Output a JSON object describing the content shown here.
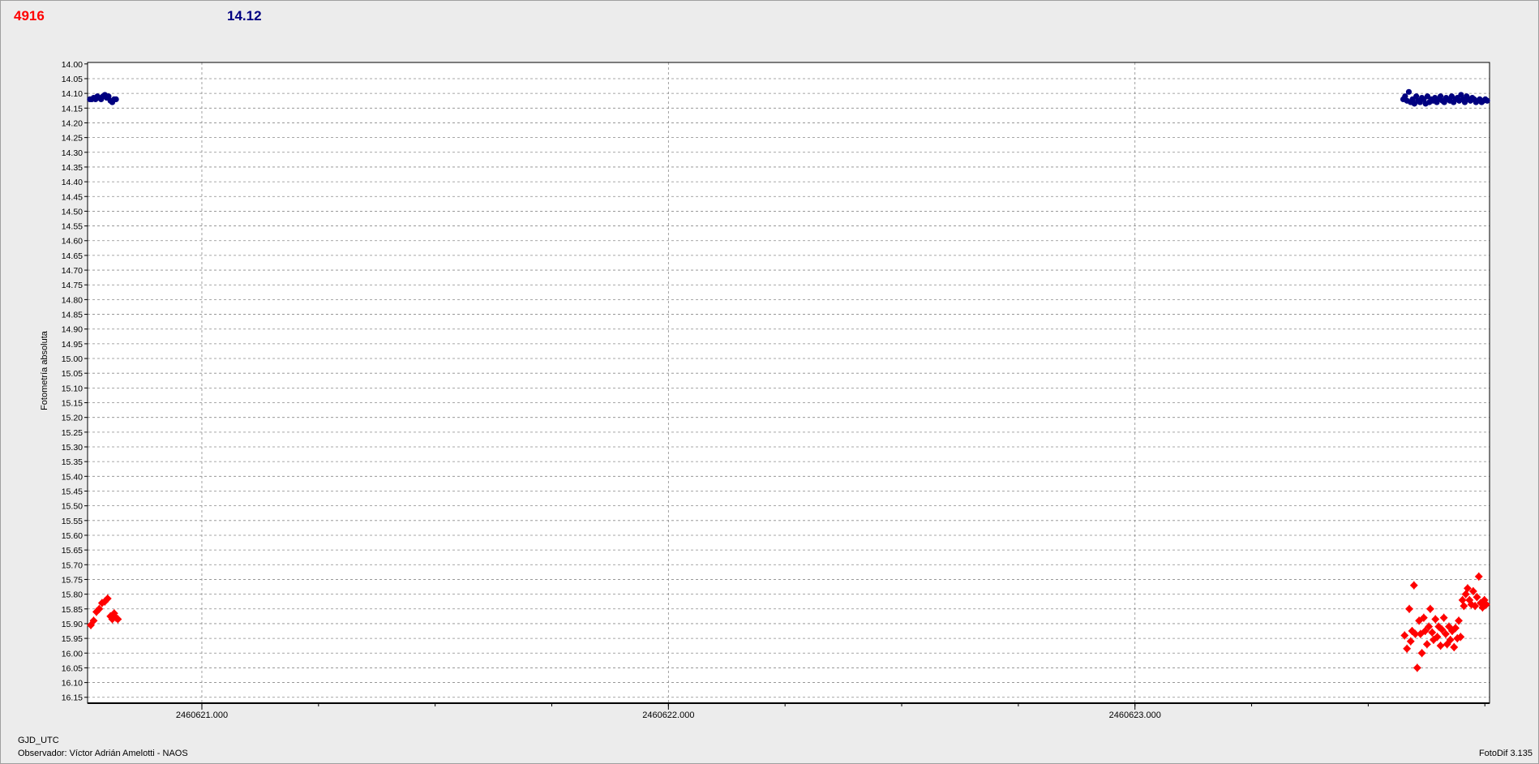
{
  "legend": [
    {
      "text": "4916",
      "color": "#ff0000"
    },
    {
      "text": "14.12",
      "color": "#000080"
    }
  ],
  "footer": {
    "xlabel": "GJD_UTC",
    "observer": "Observador: Víctor Adrián Amelotti - NAOS",
    "software": "FotoDif 3.135"
  },
  "chart_data": {
    "type": "scatter",
    "ylabel": "Fotometría absoluta",
    "xlabel": "GJD_UTC",
    "xlim": [
      2460620.755,
      2460623.76
    ],
    "ylim": [
      16.17,
      13.995
    ],
    "y_inverted": true,
    "y_ticks": [
      14.0,
      14.05,
      14.1,
      14.15,
      14.2,
      14.25,
      14.3,
      14.35,
      14.4,
      14.45,
      14.5,
      14.55,
      14.6,
      14.65,
      14.7,
      14.75,
      14.8,
      14.85,
      14.9,
      14.95,
      15.0,
      15.05,
      15.1,
      15.15,
      15.2,
      15.25,
      15.3,
      15.35,
      15.4,
      15.45,
      15.5,
      15.55,
      15.6,
      15.65,
      15.7,
      15.75,
      15.8,
      15.85,
      15.9,
      15.95,
      16.0,
      16.05,
      16.1,
      16.15
    ],
    "x_major_ticks": [
      {
        "value": 2460621.0,
        "label": "2460621.000"
      },
      {
        "value": 2460622.0,
        "label": "2460622.000"
      },
      {
        "value": 2460623.0,
        "label": "2460623.000"
      }
    ],
    "x_minor_step": 0.25,
    "grid": true,
    "series": [
      {
        "name": "14.12",
        "color": "#000080",
        "marker": "circle",
        "x": [
          2460620.76,
          2460620.764,
          2460620.768,
          2460620.772,
          2460620.776,
          2460620.78,
          2460620.784,
          2460620.788,
          2460620.792,
          2460620.796,
          2460620.8,
          2460620.804,
          2460620.808,
          2460620.812,
          2460620.816,
          2460623.575,
          2460623.579,
          2460623.583,
          2460623.587,
          2460623.591,
          2460623.595,
          2460623.599,
          2460623.603,
          2460623.607,
          2460623.611,
          2460623.615,
          2460623.619,
          2460623.623,
          2460623.627,
          2460623.631,
          2460623.635,
          2460623.639,
          2460623.643,
          2460623.647,
          2460623.651,
          2460623.655,
          2460623.659,
          2460623.663,
          2460623.667,
          2460623.671,
          2460623.675,
          2460623.679,
          2460623.683,
          2460623.687,
          2460623.691,
          2460623.695,
          2460623.699,
          2460623.703,
          2460623.707,
          2460623.711,
          2460623.715,
          2460623.719,
          2460623.723,
          2460623.727,
          2460623.731,
          2460623.735,
          2460623.739,
          2460623.743,
          2460623.747,
          2460623.751,
          2460623.755
        ],
        "y": [
          14.12,
          14.12,
          14.115,
          14.12,
          14.11,
          14.115,
          14.12,
          14.11,
          14.105,
          14.115,
          14.11,
          14.125,
          14.13,
          14.12,
          14.12,
          14.12,
          14.11,
          14.125,
          14.095,
          14.13,
          14.12,
          14.135,
          14.11,
          14.125,
          14.13,
          14.115,
          14.12,
          14.135,
          14.11,
          14.13,
          14.12,
          14.125,
          14.115,
          14.13,
          14.12,
          14.11,
          14.125,
          14.13,
          14.115,
          14.12,
          14.125,
          14.11,
          14.13,
          14.12,
          14.115,
          14.125,
          14.105,
          14.12,
          14.13,
          14.11,
          14.12,
          14.125,
          14.115,
          14.12,
          14.13,
          14.125,
          14.12,
          14.13,
          14.125,
          14.12,
          14.125
        ]
      },
      {
        "name": "4916",
        "color": "#ff0000",
        "marker": "cross",
        "x": [
          2460620.762,
          2460620.768,
          2460620.774,
          2460620.78,
          2460620.786,
          2460620.792,
          2460620.798,
          2460620.804,
          2460620.808,
          2460620.812,
          2460620.816,
          2460620.82,
          2460623.578,
          2460623.583,
          2460623.588,
          2460623.591,
          2460623.594,
          2460623.598,
          2460623.601,
          2460623.605,
          2460623.609,
          2460623.612,
          2460623.615,
          2460623.619,
          2460623.622,
          2460623.626,
          2460623.63,
          2460623.633,
          2460623.637,
          2460623.64,
          2460623.644,
          2460623.648,
          2460623.651,
          2460623.655,
          2460623.658,
          2460623.662,
          2460623.666,
          2460623.669,
          2460623.673,
          2460623.676,
          2460623.68,
          2460623.684,
          2460623.687,
          2460623.691,
          2460623.694,
          2460623.698,
          2460623.702,
          2460623.705,
          2460623.709,
          2460623.713,
          2460623.717,
          2460623.721,
          2460623.725,
          2460623.729,
          2460623.733,
          2460623.737,
          2460623.741,
          2460623.745,
          2460623.749,
          2460623.753
        ],
        "y": [
          15.905,
          15.89,
          15.86,
          15.85,
          15.83,
          15.825,
          15.815,
          15.875,
          15.885,
          15.865,
          15.88,
          15.885,
          15.94,
          15.985,
          15.85,
          15.96,
          15.925,
          15.77,
          15.935,
          16.05,
          15.89,
          15.935,
          16.0,
          15.88,
          15.925,
          15.97,
          15.91,
          15.85,
          15.93,
          15.955,
          15.885,
          15.945,
          15.91,
          15.975,
          15.92,
          15.88,
          15.935,
          15.97,
          15.91,
          15.955,
          15.925,
          15.98,
          15.915,
          15.95,
          15.89,
          15.945,
          15.82,
          15.84,
          15.8,
          15.78,
          15.82,
          15.835,
          15.79,
          15.84,
          15.81,
          15.74,
          15.83,
          15.845,
          15.82,
          15.835
        ]
      }
    ]
  }
}
